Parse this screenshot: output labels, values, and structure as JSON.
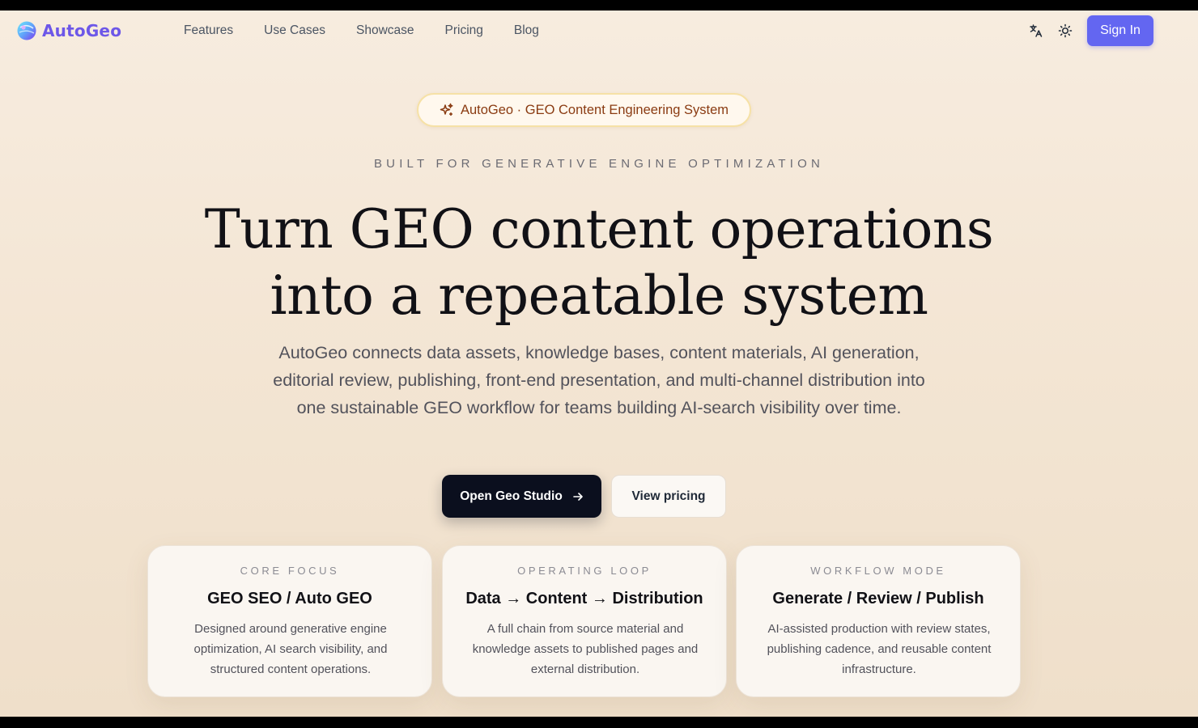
{
  "brand": {
    "name": "AutoGeo",
    "logo_icon": "globe-orb-icon",
    "brand_color": "#6d57e8"
  },
  "nav": {
    "items": [
      "Features",
      "Use Cases",
      "Showcase",
      "Pricing",
      "Blog"
    ]
  },
  "header": {
    "translate_icon": "translate-icon",
    "theme_icon": "sun-icon",
    "sign_in_label": "Sign In",
    "accent": "#6366f1"
  },
  "hero": {
    "badge_icon": "sparkles-icon",
    "badge_text": "AutoGeo · GEO Content Engineering System",
    "eyebrow": "BUILT FOR GENERATIVE ENGINE OPTIMIZATION",
    "headline_line1": "Turn GEO content operations",
    "headline_line2": "into a repeatable system",
    "lede": "AutoGeo connects data assets, knowledge bases, content materials, AI generation, editorial review, publishing, front-end presentation, and multi-channel distribution into one sustainable GEO workflow for teams building AI-search visibility over time.",
    "primary_cta": "Open Geo Studio",
    "primary_cta_icon": "arrow-right-icon",
    "secondary_cta": "View pricing"
  },
  "cards": [
    {
      "eyebrow": "CORE FOCUS",
      "title": "GEO SEO / Auto GEO",
      "body": "Designed around generative engine optimization, AI search visibility, and structured content operations."
    },
    {
      "eyebrow": "OPERATING LOOP",
      "title": "Data → Content → Distribution",
      "body": "A full chain from source material and knowledge assets to published pages and external distribution."
    },
    {
      "eyebrow": "WORKFLOW MODE",
      "title": "Generate / Review / Publish",
      "body": "AI-assisted production with review states, publishing cadence, and reusable content infrastructure."
    }
  ]
}
